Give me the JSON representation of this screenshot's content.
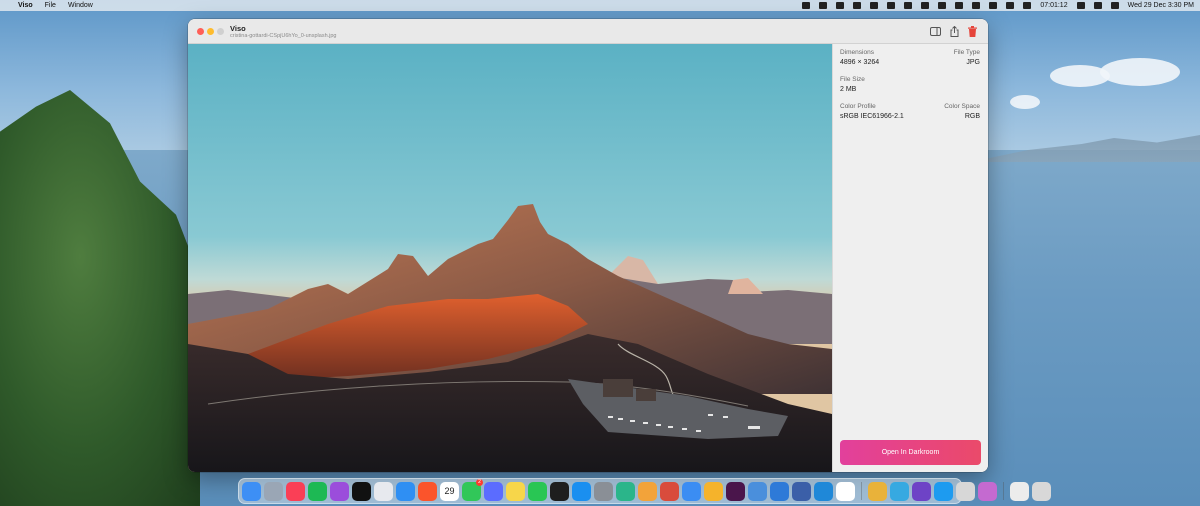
{
  "menubar": {
    "app_name": "Viso",
    "items": [
      "File",
      "Window"
    ],
    "clock": "Wed 29 Dec  3:30 PM",
    "timer": "07:01:12"
  },
  "window": {
    "title": "Viso",
    "subtitle": "cristina-gottardi-CSpjU6hYo_0-unsplash.jpg"
  },
  "info": {
    "dimensions_label": "Dimensions",
    "dimensions_value": "4896 × 3264",
    "file_type_label": "File Type",
    "file_type_value": "JPG",
    "file_size_label": "File Size",
    "file_size_value": "2 MB",
    "color_profile_label": "Color Profile",
    "color_profile_value": "sRGB IEC61966-2.1",
    "color_space_label": "Color Space",
    "color_space_value": "RGB"
  },
  "actions": {
    "open_darkroom": "Open In Darkroom"
  },
  "dock": {
    "calendar_day": "29",
    "calendar_month": "DEC",
    "messages_badge": "2",
    "icons": [
      {
        "name": "finder-icon",
        "color": "#3d8ff5"
      },
      {
        "name": "launchpad-icon",
        "color": "#9aa6b5"
      },
      {
        "name": "music-icon",
        "color": "#fa3f56"
      },
      {
        "name": "spotify-icon",
        "color": "#1db954"
      },
      {
        "name": "podcasts-icon",
        "color": "#9b4ddb"
      },
      {
        "name": "apple-tv-icon",
        "color": "#111111"
      },
      {
        "name": "app-grid-icon",
        "color": "#e7e9ee"
      },
      {
        "name": "safari-icon",
        "color": "#2f8ff3"
      },
      {
        "name": "brave-icon",
        "color": "#fb542b"
      },
      {
        "name": "calendar-icon",
        "color": "#ffffff"
      },
      {
        "name": "messages-icon",
        "color": "#31c759"
      },
      {
        "name": "mosaic-icon",
        "color": "#5b6cff"
      },
      {
        "name": "notes-icon",
        "color": "#f7d64a"
      },
      {
        "name": "facetime-icon",
        "color": "#29c654"
      },
      {
        "name": "terminal-icon",
        "color": "#1e1e1e"
      },
      {
        "name": "app-store-icon",
        "color": "#1a8ff0"
      },
      {
        "name": "system-preferences-icon",
        "color": "#8a8f96"
      },
      {
        "name": "chatgpt-icon",
        "color": "#2bb58a"
      },
      {
        "name": "darkroom-icon",
        "color": "#f2a33a"
      },
      {
        "name": "affinity-icon",
        "color": "#d94c3c"
      },
      {
        "name": "mail-icon",
        "color": "#3b8df3"
      },
      {
        "name": "sketch-icon",
        "color": "#f5b32b"
      },
      {
        "name": "slack-icon",
        "color": "#4a154b"
      },
      {
        "name": "preview-icon",
        "color": "#4a8fdc"
      },
      {
        "name": "xcode-icon",
        "color": "#2e7ad8"
      },
      {
        "name": "mosaic-grid-icon",
        "color": "#3b5fa8"
      },
      {
        "name": "vscode-icon",
        "color": "#1f88d8"
      },
      {
        "name": "chrome-icon",
        "color": "#ffffff"
      }
    ],
    "right_icons": [
      {
        "name": "preview-glasses-icon",
        "color": "#e9b23a"
      },
      {
        "name": "telegram-icon",
        "color": "#36a9e1"
      },
      {
        "name": "github-icon",
        "color": "#6e43c6"
      },
      {
        "name": "twitter-icon",
        "color": "#1d9bf0"
      },
      {
        "name": "jar-icon",
        "color": "#d7d7d7"
      },
      {
        "name": "photo-icon",
        "color": "#c46ad0"
      }
    ],
    "trailing_icons": [
      {
        "name": "document-icon",
        "color": "#ececec"
      },
      {
        "name": "trash-icon",
        "color": "#d8d8d8"
      }
    ]
  }
}
